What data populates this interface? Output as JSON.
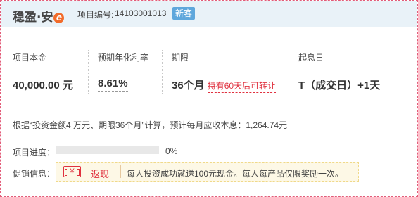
{
  "header": {
    "brand": "稳盈·安",
    "brand_mark": "e",
    "project_number_label": "项目编号:",
    "project_number": "14103001013",
    "badge": "新客"
  },
  "metrics": {
    "principal": {
      "label": "项目本金",
      "value": "40,000.00 元"
    },
    "rate": {
      "label": "预期年化利率",
      "value": "8.61%"
    },
    "term": {
      "label": "期限",
      "value": "36个月",
      "note": "持有60天后可转让"
    },
    "start": {
      "label": "起息日",
      "value": "T（成交日）+1天"
    }
  },
  "calc_text": "根据“投资金额4 万元、期限36个月”计算，预计每月应收本息：1,264.74元",
  "progress": {
    "label": "项目进度：",
    "percent_text": "0%",
    "fraction": 0
  },
  "promo": {
    "label": "促销信息：",
    "icon_text": "¥",
    "tag": "返现",
    "text": "每人投资成功就送100元现金。每人每产品仅限奖励一次。"
  },
  "colors": {
    "accent": "#f26b2a",
    "red": "#e0313f",
    "header_bg": "#e9f2f8",
    "badge_bg": "#5fa7dc"
  }
}
